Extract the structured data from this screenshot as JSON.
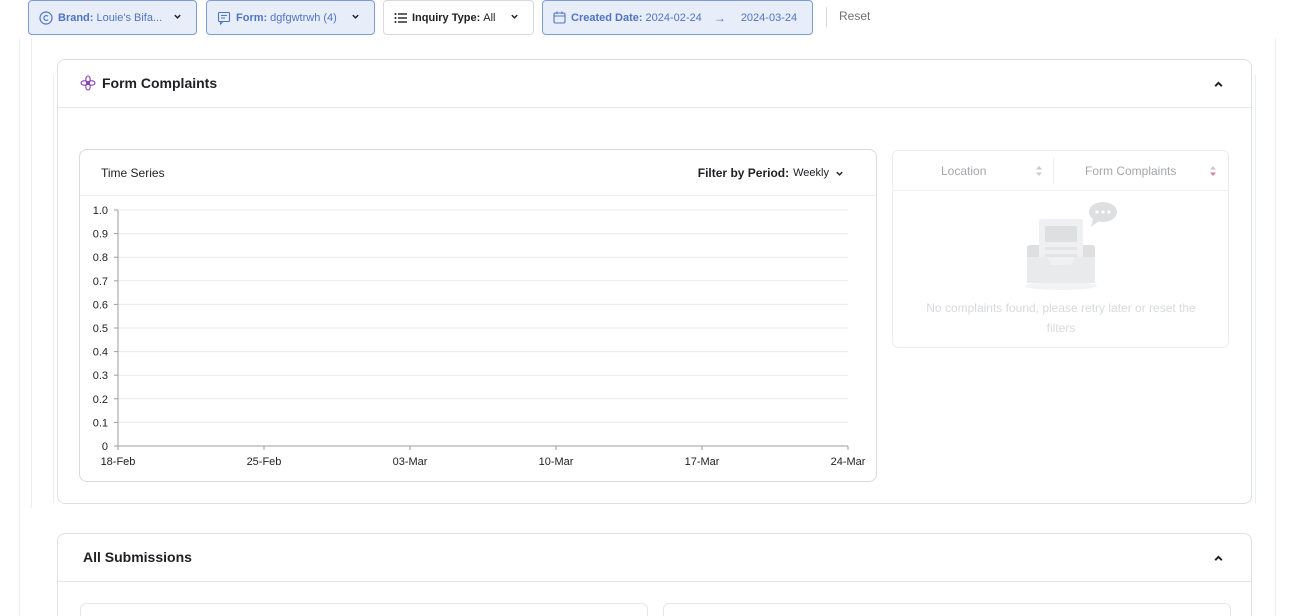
{
  "filters": {
    "brand": {
      "label": "Brand:",
      "value": "Louie's Bifa..."
    },
    "form": {
      "label": "Form:",
      "value": "dgfgwtrwh (4)"
    },
    "inquiry": {
      "label": "Inquiry Type:",
      "value": "All"
    },
    "created": {
      "label": "Created Date:",
      "start": "2024-02-24",
      "arrow": "→",
      "end": "2024-03-24"
    },
    "reset": "Reset"
  },
  "colors": {
    "accent": "#4f74c3",
    "accent_bg": "#e8eef9",
    "brand_icon": "#8a3fa8"
  },
  "form_complaints": {
    "title": "Form Complaints",
    "icon": "flower-icon",
    "time_series": {
      "title": "Time Series",
      "period_label": "Filter by Period:",
      "period_value": "Weekly"
    },
    "table": {
      "columns": [
        "Location",
        "Form Complaints"
      ],
      "empty_message": "No complaints found, please retry later or reset the filters"
    }
  },
  "all_submissions": {
    "title": "All Submissions"
  },
  "chart_data": {
    "type": "line",
    "title": "Time Series",
    "xlabel": "",
    "ylabel": "",
    "x": [
      "18-Feb",
      "25-Feb",
      "03-Mar",
      "10-Mar",
      "17-Mar",
      "24-Mar"
    ],
    "yticks": [
      "0",
      "0.1",
      "0.2",
      "0.3",
      "0.4",
      "0.5",
      "0.6",
      "0.7",
      "0.8",
      "0.9",
      "1.0"
    ],
    "ylim": [
      0,
      1
    ],
    "series": [],
    "grid": true
  }
}
